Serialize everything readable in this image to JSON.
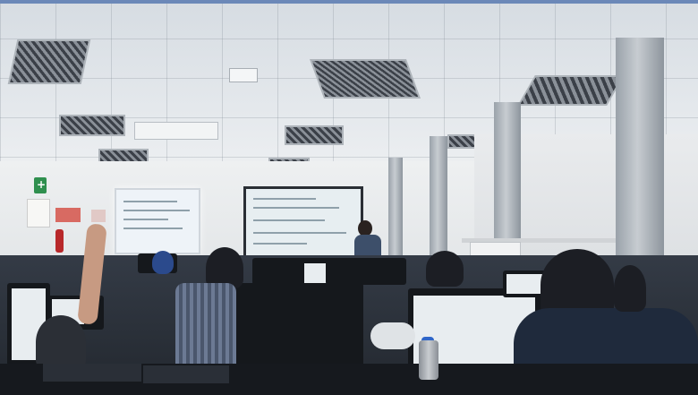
{
  "scene": {
    "description_tag": "classroom-photo",
    "colors": {
      "ceiling": "#e4e8ec",
      "wall": "#eef0f1",
      "desk": "#22272e",
      "accent_stripe": "#6b88b8"
    }
  }
}
